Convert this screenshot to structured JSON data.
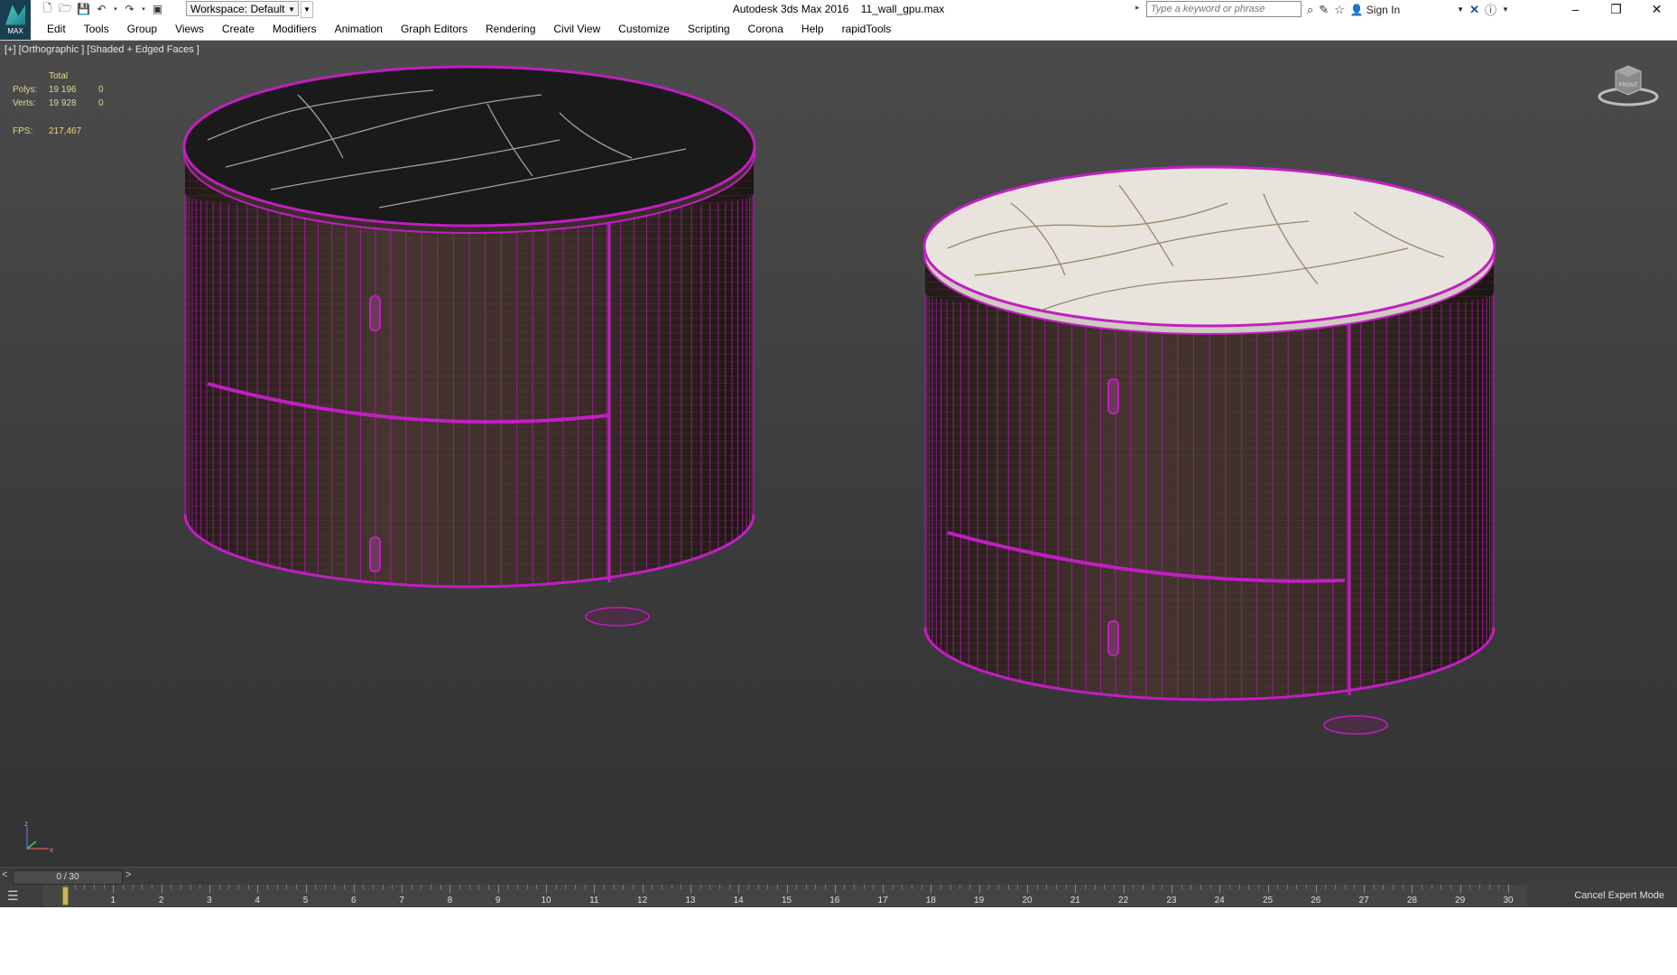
{
  "app": {
    "logo_text": "MAX",
    "title": "Autodesk 3ds Max 2016",
    "file_name": "11_wall_gpu.max"
  },
  "quick_access": {
    "icons": [
      "new-file-icon",
      "open-file-icon",
      "save-icon",
      "undo-icon",
      "redo-icon",
      "project-folder-icon"
    ],
    "workspace": "Workspace: Default"
  },
  "search": {
    "placeholder": "Type a keyword or phrase"
  },
  "title_tools": {
    "sign_in": "Sign In",
    "icons": [
      "binoculars-icon",
      "communication-icon",
      "favorites-icon",
      "user-icon",
      "exchange-icon",
      "help-icon"
    ]
  },
  "window_controls": {
    "minimize": "–",
    "restore": "❐",
    "close": "✕"
  },
  "menu": [
    "Edit",
    "Tools",
    "Group",
    "Views",
    "Create",
    "Modifiers",
    "Animation",
    "Graph Editors",
    "Rendering",
    "Civil View",
    "Customize",
    "Scripting",
    "Corona",
    "Help",
    "rapidTools"
  ],
  "viewport": {
    "label": "[+] [Orthographic ] [Shaded + Edged Faces ]",
    "stats": {
      "header": "Total",
      "polys_label": "Polys:",
      "polys_value": "19 196",
      "polys_sel": "0",
      "verts_label": "Verts:",
      "verts_value": "19 928",
      "verts_sel": "0",
      "fps_label": "FPS:",
      "fps_value": "217,467"
    },
    "viewcube_label": "FRONT",
    "objects": [
      {
        "name": "nightstand-dark-marble",
        "top_color": "#1a1a1a",
        "vein_color": "#cfcfcf",
        "body_color": "#3f302b"
      },
      {
        "name": "nightstand-white-marble",
        "top_color": "#e8e4dd",
        "vein_color": "#8a6a4a",
        "body_color": "#3a2b27"
      }
    ],
    "wire_color": "#c21ec2",
    "axis_labels": {
      "z": "z",
      "x": "x"
    }
  },
  "timeline": {
    "frame_counter": "0 / 30",
    "prev": "<",
    "next": ">",
    "current_frame": 0,
    "ticks": [
      "0",
      "1",
      "2",
      "3",
      "4",
      "5",
      "6",
      "7",
      "8",
      "9",
      "10",
      "11",
      "12",
      "13",
      "14",
      "15",
      "16",
      "17",
      "18",
      "19",
      "20",
      "21",
      "22",
      "23",
      "24",
      "25",
      "26",
      "27",
      "28",
      "29",
      "30"
    ],
    "cancel_expert": "Cancel Expert Mode"
  }
}
